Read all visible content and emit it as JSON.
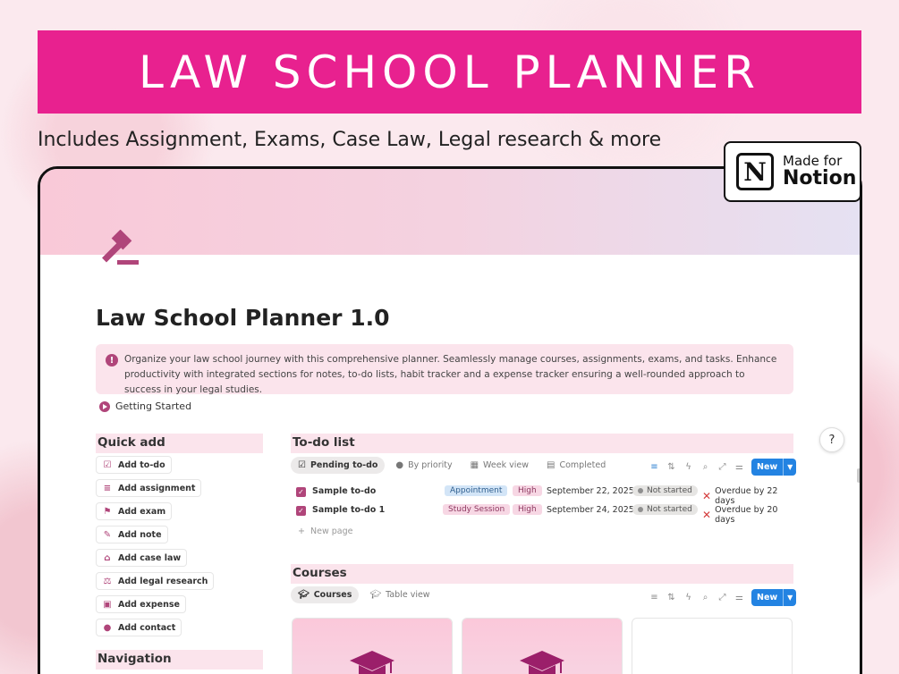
{
  "banner": {
    "title": "LAW SCHOOL PLANNER"
  },
  "subtitle": "Includes Assignment, Exams, Case Law, Legal research & more",
  "notion_badge": {
    "logo": "N",
    "made_for": "Made for",
    "name": "Notion"
  },
  "page": {
    "icon": "gavel-icon",
    "title": "Law School Planner 1.0",
    "callout": "Organize your law school journey with this comprehensive planner. Seamlessly manage courses, assignments, exams, and tasks. Enhance productivity with integrated sections for notes, to-do lists, habit tracker and a expense tracker ensuring a well-rounded approach to success in your legal studies.",
    "getting_started": "Getting Started"
  },
  "quick_add": {
    "heading": "Quick add",
    "items": [
      {
        "label": "Add to-do",
        "icon": "checkbox-icon"
      },
      {
        "label": "Add assignment",
        "icon": "edit-list-icon"
      },
      {
        "label": "Add exam",
        "icon": "flag-icon"
      },
      {
        "label": "Add note",
        "icon": "pencil-icon"
      },
      {
        "label": "Add case law",
        "icon": "bank-icon"
      },
      {
        "label": "Add legal research",
        "icon": "gavel-icon"
      },
      {
        "label": "Add expense",
        "icon": "money-icon"
      },
      {
        "label": "Add contact",
        "icon": "person-icon"
      }
    ]
  },
  "navigation": {
    "heading": "Navigation"
  },
  "todo": {
    "heading": "To-do list",
    "tabs": [
      {
        "label": "Pending to-do",
        "icon": "checkbox-icon",
        "active": true
      },
      {
        "label": "By priority",
        "icon": "alert-icon"
      },
      {
        "label": "Week view",
        "icon": "calendar-icon"
      },
      {
        "label": "Completed",
        "icon": "archive-icon"
      }
    ],
    "new_label": "New",
    "rows": [
      {
        "name": "Sample to-do",
        "type": "Appointment",
        "priority": "High",
        "date": "September 22, 2025",
        "status": "Not started",
        "overdue": "Overdue by 22 days"
      },
      {
        "name": "Sample to-do 1",
        "type": "Study Session",
        "priority": "High",
        "date": "September 24, 2025",
        "status": "Not started",
        "overdue": "Overdue by 20 days"
      }
    ],
    "new_page": "New page"
  },
  "courses": {
    "heading": "Courses",
    "tabs": [
      {
        "label": "Courses",
        "icon": "graduation-cap-icon",
        "active": true
      },
      {
        "label": "Table view",
        "icon": "graduation-cap-icon"
      }
    ],
    "new_label": "New"
  },
  "colors": {
    "brand_pink": "#e8218f",
    "accent": "#b0457a",
    "blue": "#2383e2"
  }
}
